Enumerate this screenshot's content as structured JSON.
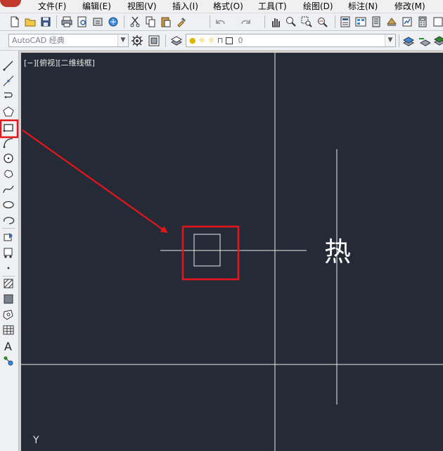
{
  "menu": {
    "items": [
      {
        "label": "文件(F)"
      },
      {
        "label": "编辑(E)"
      },
      {
        "label": "视图(V)"
      },
      {
        "label": "插入(I)"
      },
      {
        "label": "格式(O)"
      },
      {
        "label": "工具(T)"
      },
      {
        "label": "绘图(D)"
      },
      {
        "label": "标注(N)"
      },
      {
        "label": "修改(M)"
      }
    ]
  },
  "toolbar": {
    "workspace": "AutoCAD 经典",
    "layer": "0"
  },
  "canvas": {
    "viewport_label": "[−][俯视][二维线框]",
    "text": "热",
    "ucs_y": "Y",
    "background": "#252b36"
  },
  "annotation": {
    "color": "#e8141c"
  }
}
